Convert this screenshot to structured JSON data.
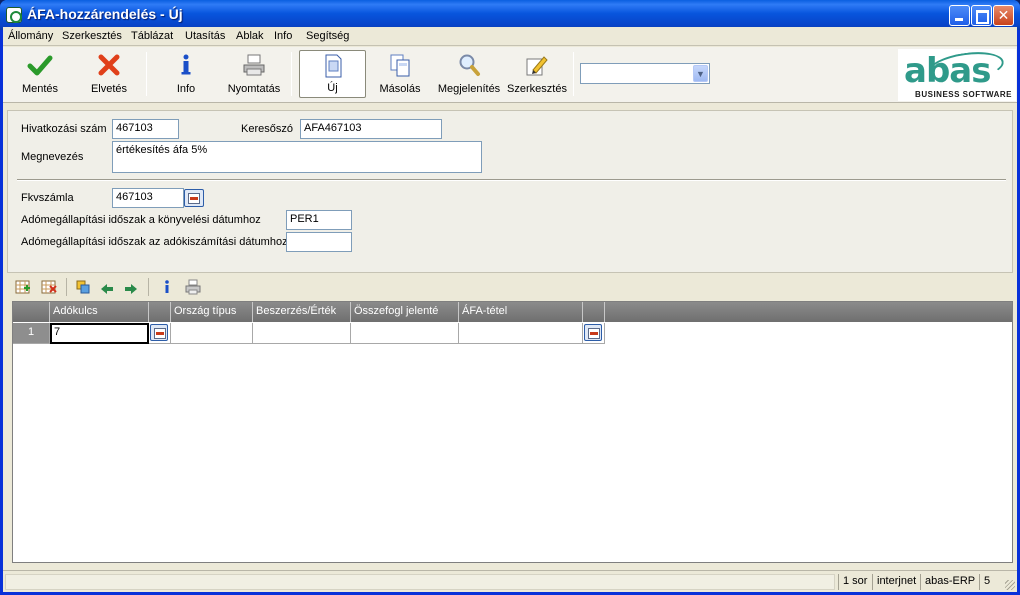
{
  "window": {
    "title": "ÁFA-hozzárendelés - Új"
  },
  "menu": [
    "Állomány",
    "Szerkesztés",
    "Táblázat",
    "Utasítás",
    "Ablak",
    "Info",
    "Segítség"
  ],
  "toolbar": {
    "save": "Mentés",
    "discard": "Elvetés",
    "info": "Info",
    "print": "Nyomtatás",
    "new": "Új",
    "copy": "Másolás",
    "display": "Megjelenítés",
    "edit": "Szerkesztés",
    "combo_value": ""
  },
  "logo": {
    "word": "abas",
    "sub": "BUSINESS SOFTWARE"
  },
  "form": {
    "ref_label": "Hivatkozási szám",
    "ref_value": "467103",
    "keyword_label": "Keresőszó",
    "keyword_value": "AFA467103",
    "name_label": "Megnevezés",
    "name_value": "értékesítés áfa 5%",
    "account_label": "Fkvszámla",
    "account_value": "467103",
    "period_book_label": "Adómegállapítási időszak a könyvelési dátumhoz",
    "period_book_value": "PER1",
    "period_tax_label": "Adómegállapítási időszak az adókiszámítási dátumhoz",
    "period_tax_value": ""
  },
  "grid": {
    "columns": [
      "Adókulcs",
      "",
      "Ország típus",
      "Beszerzés/Érték",
      "Összefogl jelenté",
      "ÁFA-tétel",
      ""
    ],
    "rows": [
      {
        "num": "1",
        "cells": [
          "7",
          "",
          "",
          "",
          "",
          ""
        ]
      }
    ]
  },
  "status": {
    "rows": "1 sor",
    "network": "interjnet",
    "app": "abas-ERP",
    "num": "5"
  }
}
